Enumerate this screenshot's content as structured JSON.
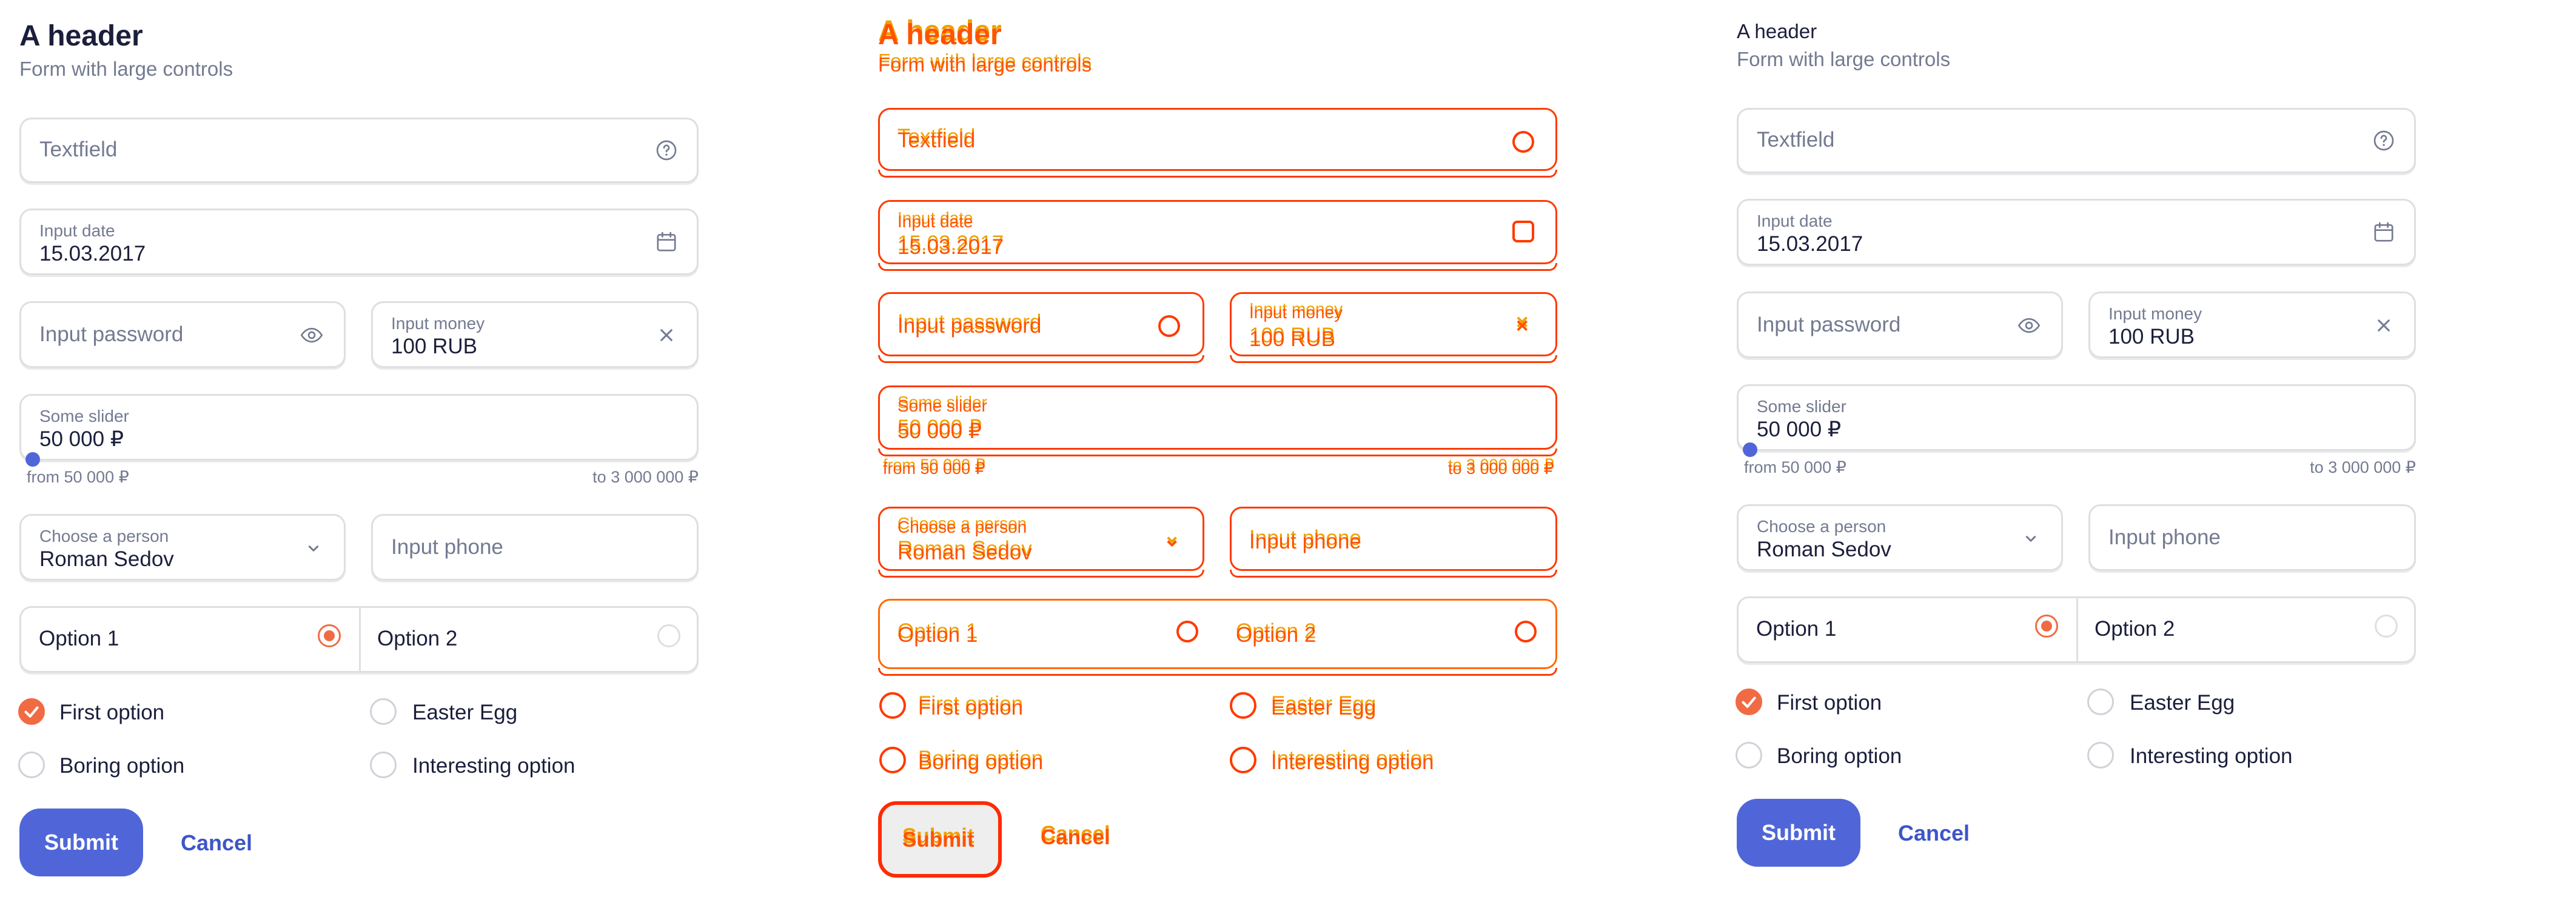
{
  "form": {
    "title": "A header",
    "subtitle": "Form with large controls",
    "textfield": {
      "placeholder": "Textfield",
      "icon": "help-circle-icon"
    },
    "date": {
      "label": "Input date",
      "value": "15.03.2017",
      "icon": "calendar-icon"
    },
    "password": {
      "placeholder": "Input password",
      "icon": "eye-icon"
    },
    "money": {
      "label": "Input money",
      "value": "100 RUB",
      "icon": "close-icon"
    },
    "slider": {
      "label": "Some slider",
      "value": "50 000 ₽",
      "min_label": "from 50 000 ₽",
      "max_label": "to 3 000 000 ₽",
      "position": 0.0
    },
    "person": {
      "label": "Choose a person",
      "value": "Roman Sedov",
      "icon": "chevron-down-icon"
    },
    "phone": {
      "placeholder": "Input phone"
    },
    "segmented": [
      {
        "label": "Option 1",
        "selected": true
      },
      {
        "label": "Option 2",
        "selected": false
      }
    ],
    "checkboxes": [
      {
        "label": "First option",
        "checked": true
      },
      {
        "label": "Easter Egg",
        "checked": false
      },
      {
        "label": "Boring option",
        "checked": false
      },
      {
        "label": "Interesting option",
        "checked": false
      }
    ],
    "submit_label": "Submit",
    "cancel_label": "Cancel"
  },
  "colors": {
    "accent": "#f06b43",
    "primary": "#5066d8",
    "link": "#3d55c7",
    "border": "#dddfe0",
    "muted_text": "#737a91",
    "overlay_red": "#ff3a00",
    "overlay_orange": "#f0a000"
  }
}
